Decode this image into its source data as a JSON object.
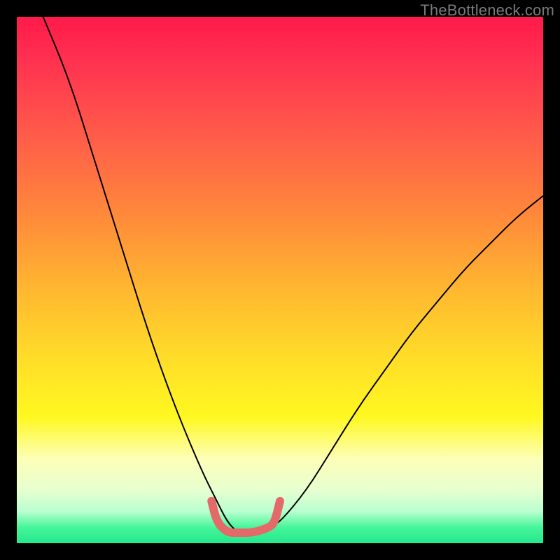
{
  "watermark": "TheBottleneck.com",
  "colors": {
    "frame": "#000000",
    "curve_stroke": "#000000",
    "highlight_stroke": "#e46a6a",
    "watermark_text": "#7a7a7a"
  },
  "chart_data": {
    "type": "line",
    "title": "",
    "xlabel": "",
    "ylabel": "",
    "xlim": [
      0,
      100
    ],
    "ylim": [
      0,
      100
    ],
    "note": "Axes implied by plot area; no tick labels are shown. Values are percent; y=0 is green bottom, y=100 is red top.",
    "series": [
      {
        "name": "primary-curve",
        "stroke": "curve_stroke",
        "x": [
          5,
          10,
          15,
          20,
          25,
          30,
          35,
          38,
          40,
          42,
          45,
          48,
          50,
          55,
          60,
          65,
          70,
          75,
          80,
          85,
          90,
          95,
          100
        ],
        "y": [
          100,
          88,
          72,
          56,
          40,
          26,
          14,
          8,
          4,
          2,
          2,
          3,
          4,
          10,
          18,
          26,
          33,
          40,
          46,
          52,
          57,
          62,
          66
        ]
      },
      {
        "name": "bottom-highlight",
        "stroke": "highlight_stroke",
        "x": [
          37,
          38,
          40,
          42,
          45,
          48,
          49,
          50
        ],
        "y": [
          8,
          4,
          2,
          2,
          2,
          3,
          4,
          8
        ]
      }
    ]
  }
}
